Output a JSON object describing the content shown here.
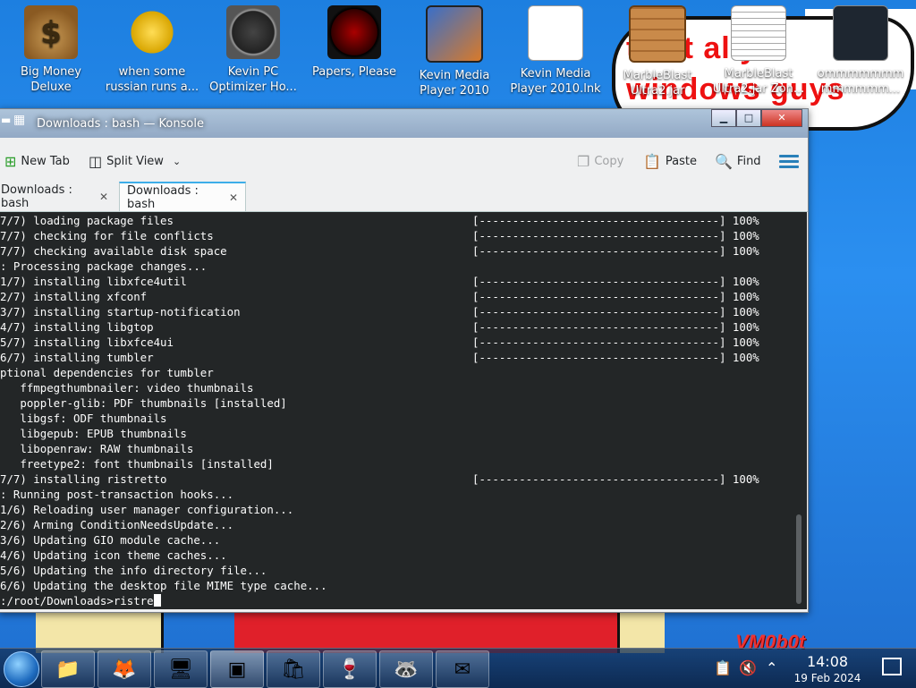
{
  "desktop": {
    "icons": [
      {
        "label_line1": "Big Money",
        "label_line2": "Deluxe",
        "icon": "money-bag-icon"
      },
      {
        "label_line1": "when some",
        "label_line2": "russian runs a...",
        "icon": "gear-icon"
      },
      {
        "label_line1": "Kevin PC",
        "label_line2": "Optimizer Ho...",
        "icon": "gauge-icon"
      },
      {
        "label_line1": "Papers, Please",
        "label_line2": "",
        "icon": "papers-please-icon"
      },
      {
        "label_line1": "Kevin Media",
        "label_line2": "Player 2010",
        "icon": "film-icon"
      },
      {
        "label_line1": "Kevin Media",
        "label_line2": "Player 2010.lnk",
        "icon": "shortcut-icon"
      },
      {
        "label_line1": "MarbleBlast",
        "label_line2": "Ultra2.jar",
        "icon": "crate-icon"
      },
      {
        "label_line1": "MarbleBlast",
        "label_line2": "Ultra2.jar Zon...",
        "icon": "text-file-icon"
      },
      {
        "label_line1": "ommmmmmm",
        "label_line2": "mmmmmm...",
        "icon": "dark-image-icon"
      }
    ],
    "wallpaper_text_1": "t is t ally",
    "wallpaper_text_2": "windows guys",
    "wallpaper_mark": "VM0b0t"
  },
  "window": {
    "title": "Downloads : bash — Konsole",
    "controls": {
      "minimize": "▁",
      "maximize": "□",
      "close": "✕"
    }
  },
  "toolbar": {
    "new_tab": "New Tab",
    "split_view": "Split View",
    "copy": "Copy",
    "paste": "Paste",
    "find": "Find"
  },
  "tabs": [
    {
      "label": "Downloads : bash",
      "active": false
    },
    {
      "label": "Downloads : bash",
      "active": true
    }
  ],
  "terminal": {
    "lines": [
      {
        "text": "7/7) loading package files",
        "progress": "[------------------------------------] 100%"
      },
      {
        "text": "7/7) checking for file conflicts",
        "progress": "[------------------------------------] 100%"
      },
      {
        "text": "7/7) checking available disk space",
        "progress": "[------------------------------------] 100%"
      },
      {
        "text": ": Processing package changes...",
        "progress": ""
      },
      {
        "text": "1/7) installing libxfce4util",
        "progress": "[------------------------------------] 100%"
      },
      {
        "text": "2/7) installing xfconf",
        "progress": "[------------------------------------] 100%"
      },
      {
        "text": "3/7) installing startup-notification",
        "progress": "[------------------------------------] 100%"
      },
      {
        "text": "4/7) installing libgtop",
        "progress": "[------------------------------------] 100%"
      },
      {
        "text": "5/7) installing libxfce4ui",
        "progress": "[------------------------------------] 100%"
      },
      {
        "text": "6/7) installing tumbler",
        "progress": "[------------------------------------] 100%"
      },
      {
        "text": "ptional dependencies for tumbler",
        "progress": ""
      },
      {
        "text": "   ffmpegthumbnailer: video thumbnails",
        "progress": ""
      },
      {
        "text": "   poppler-glib: PDF thumbnails [installed]",
        "progress": ""
      },
      {
        "text": "   libgsf: ODF thumbnails",
        "progress": ""
      },
      {
        "text": "   libgepub: EPUB thumbnails",
        "progress": ""
      },
      {
        "text": "   libopenraw: RAW thumbnails",
        "progress": ""
      },
      {
        "text": "   freetype2: font thumbnails [installed]",
        "progress": ""
      },
      {
        "text": "7/7) installing ristretto",
        "progress": "[------------------------------------] 100%"
      },
      {
        "text": ": Running post-transaction hooks...",
        "progress": ""
      },
      {
        "text": "1/6) Reloading user manager configuration...",
        "progress": ""
      },
      {
        "text": "2/6) Arming ConditionNeedsUpdate...",
        "progress": ""
      },
      {
        "text": "3/6) Updating GIO module cache...",
        "progress": ""
      },
      {
        "text": "4/6) Updating icon theme caches...",
        "progress": ""
      },
      {
        "text": "5/6) Updating the info directory file...",
        "progress": ""
      },
      {
        "text": "6/6) Updating the desktop file MIME type cache...",
        "progress": ""
      }
    ],
    "prompt": ":/root/Downloads>ristre"
  },
  "taskbar": {
    "apps": [
      "file-manager-icon",
      "firefox-icon",
      "control-panel-icon",
      "konsole-icon",
      "bag-icon",
      "wine-icon",
      "raccoon-icon",
      "thunderbird-icon"
    ],
    "time": "14:08",
    "date": "19 Feb 2024"
  }
}
